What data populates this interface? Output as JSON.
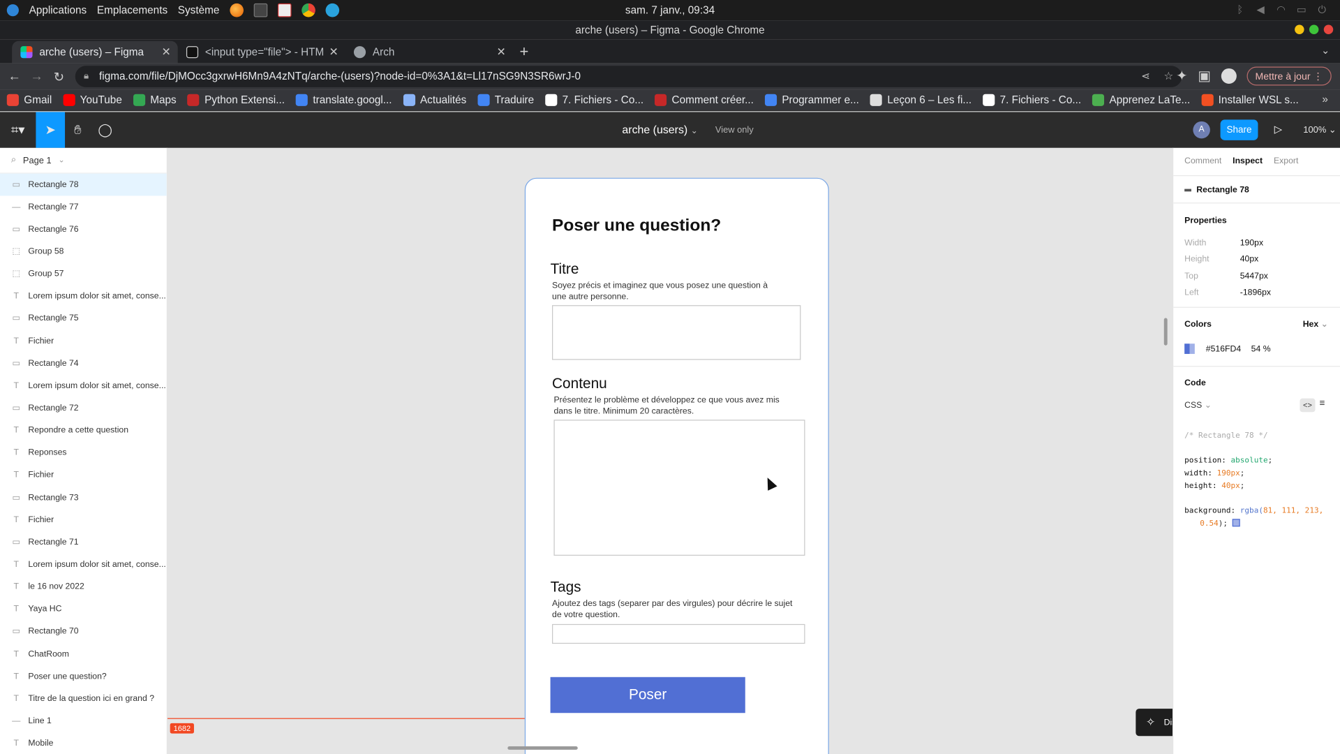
{
  "os_bar": {
    "applications": "Applications",
    "places": "Emplacements",
    "system": "Système",
    "clock": "sam. 7 janv., 09:34"
  },
  "window": {
    "title": "arche (users) – Figma - Google Chrome"
  },
  "tabs": [
    {
      "label": "arche (users) – Figma"
    },
    {
      "label": "<input type=\"file\"> - HTM"
    },
    {
      "label": "Arch"
    }
  ],
  "address": {
    "url": "figma.com/file/DjMOcc3gxrwH6Mn9A4zNTq/arche-(users)?node-id=0%3A1&t=Ll17nSG9N3SR6wrJ-0",
    "update_button": "Mettre à jour"
  },
  "bookmarks": [
    {
      "label": "Gmail",
      "color": "#ea4335"
    },
    {
      "label": "YouTube",
      "color": "#ff0000"
    },
    {
      "label": "Maps",
      "color": "#34a853"
    },
    {
      "label": "Python Extensi...",
      "color": "#c62828"
    },
    {
      "label": "translate.googl...",
      "color": "#4285f4"
    },
    {
      "label": "Actualités",
      "color": "#8ab4f8"
    },
    {
      "label": "Traduire",
      "color": "#4285f4"
    },
    {
      "label": "7. Fichiers - Co...",
      "color": "#ffffff"
    },
    {
      "label": "Comment créer...",
      "color": "#c62828"
    },
    {
      "label": "Programmer e...",
      "color": "#4285f4"
    },
    {
      "label": "Leçon 6 – Les fi...",
      "color": "#dddddd"
    },
    {
      "label": "7. Fichiers - Co...",
      "color": "#ffffff"
    },
    {
      "label": "Apprenez LaTe...",
      "color": "#4caf50"
    },
    {
      "label": "Installer WSL s...",
      "color": "#f25022"
    }
  ],
  "figma_toolbar": {
    "doc_title": "arche (users)",
    "view_only": "View only",
    "avatar": "A",
    "share": "Share",
    "zoom": "100%"
  },
  "layers_panel": {
    "page": "Page 1",
    "items": [
      {
        "icon": "rect",
        "label": "Rectangle 78"
      },
      {
        "icon": "line",
        "label": "Rectangle 77"
      },
      {
        "icon": "rect",
        "label": "Rectangle 76"
      },
      {
        "icon": "group",
        "label": "Group 58"
      },
      {
        "icon": "group",
        "label": "Group 57"
      },
      {
        "icon": "text",
        "label": "Lorem ipsum dolor sit amet, conse..."
      },
      {
        "icon": "rect",
        "label": "Rectangle 75"
      },
      {
        "icon": "text",
        "label": "Fichier"
      },
      {
        "icon": "rect",
        "label": "Rectangle 74"
      },
      {
        "icon": "text",
        "label": "Lorem ipsum dolor sit amet, conse..."
      },
      {
        "icon": "rect",
        "label": "Rectangle 72"
      },
      {
        "icon": "text",
        "label": "Repondre a cette question"
      },
      {
        "icon": "text",
        "label": "Reponses"
      },
      {
        "icon": "text",
        "label": "Fichier"
      },
      {
        "icon": "rect",
        "label": "Rectangle 73"
      },
      {
        "icon": "text",
        "label": "Fichier"
      },
      {
        "icon": "rect",
        "label": "Rectangle 71"
      },
      {
        "icon": "text",
        "label": "Lorem ipsum dolor sit amet, conse..."
      },
      {
        "icon": "text",
        "label": "le 16 nov 2022"
      },
      {
        "icon": "text",
        "label": "Yaya HC"
      },
      {
        "icon": "rect",
        "label": "Rectangle 70"
      },
      {
        "icon": "text",
        "label": "ChatRoom"
      },
      {
        "icon": "text",
        "label": "Poser une question?"
      },
      {
        "icon": "text",
        "label": "Titre de la question ici en grand ?"
      },
      {
        "icon": "line",
        "label": "Line 1"
      },
      {
        "icon": "text",
        "label": "Mobile"
      }
    ]
  },
  "frame": {
    "title": "Poser une question?",
    "titre_label": "Titre",
    "titre_desc": "Soyez précis et imaginez que vous posez une question à une autre personne.",
    "contenu_label": "Contenu",
    "contenu_desc": "Présentez le problème et développez ce que vous avez mis dans le titre. Minimum 20 caractères.",
    "tags_label": "Tags",
    "tags_desc": "Ajoutez des tags (separer par des virgules) pour décrire le sujet de votre question.",
    "submit": "Poser",
    "submit_color": "#516fd4"
  },
  "canvas": {
    "guide_value": "1682",
    "discover": "Discover more features",
    "help": "?"
  },
  "inspect_panel": {
    "tabs": [
      "Comment",
      "Inspect",
      "Export"
    ],
    "selected": "Rectangle 78",
    "properties_title": "Properties",
    "properties": [
      {
        "key": "Width",
        "value": "190px"
      },
      {
        "key": "Height",
        "value": "40px"
      },
      {
        "key": "Top",
        "value": "5447px"
      },
      {
        "key": "Left",
        "value": "-1896px"
      }
    ],
    "colors_title": "Colors",
    "color_format": "Hex",
    "color_hex": "#516FD4",
    "color_opacity": "54 %",
    "code_title": "Code",
    "code_lang": "CSS",
    "code_comment": "/* Rectangle 78 */",
    "code_position_k": "position:",
    "code_position_v": "absolute",
    "code_width_k": "width:",
    "code_width_v": "190px",
    "code_height_k": "height:",
    "code_height_v": "40px",
    "code_bg_k": "background:",
    "code_bg_fn": "rgba(",
    "code_bg_nums1": "81, 111, 213,",
    "code_bg_nums2": "0.54",
    "code_bg_close": ");"
  }
}
